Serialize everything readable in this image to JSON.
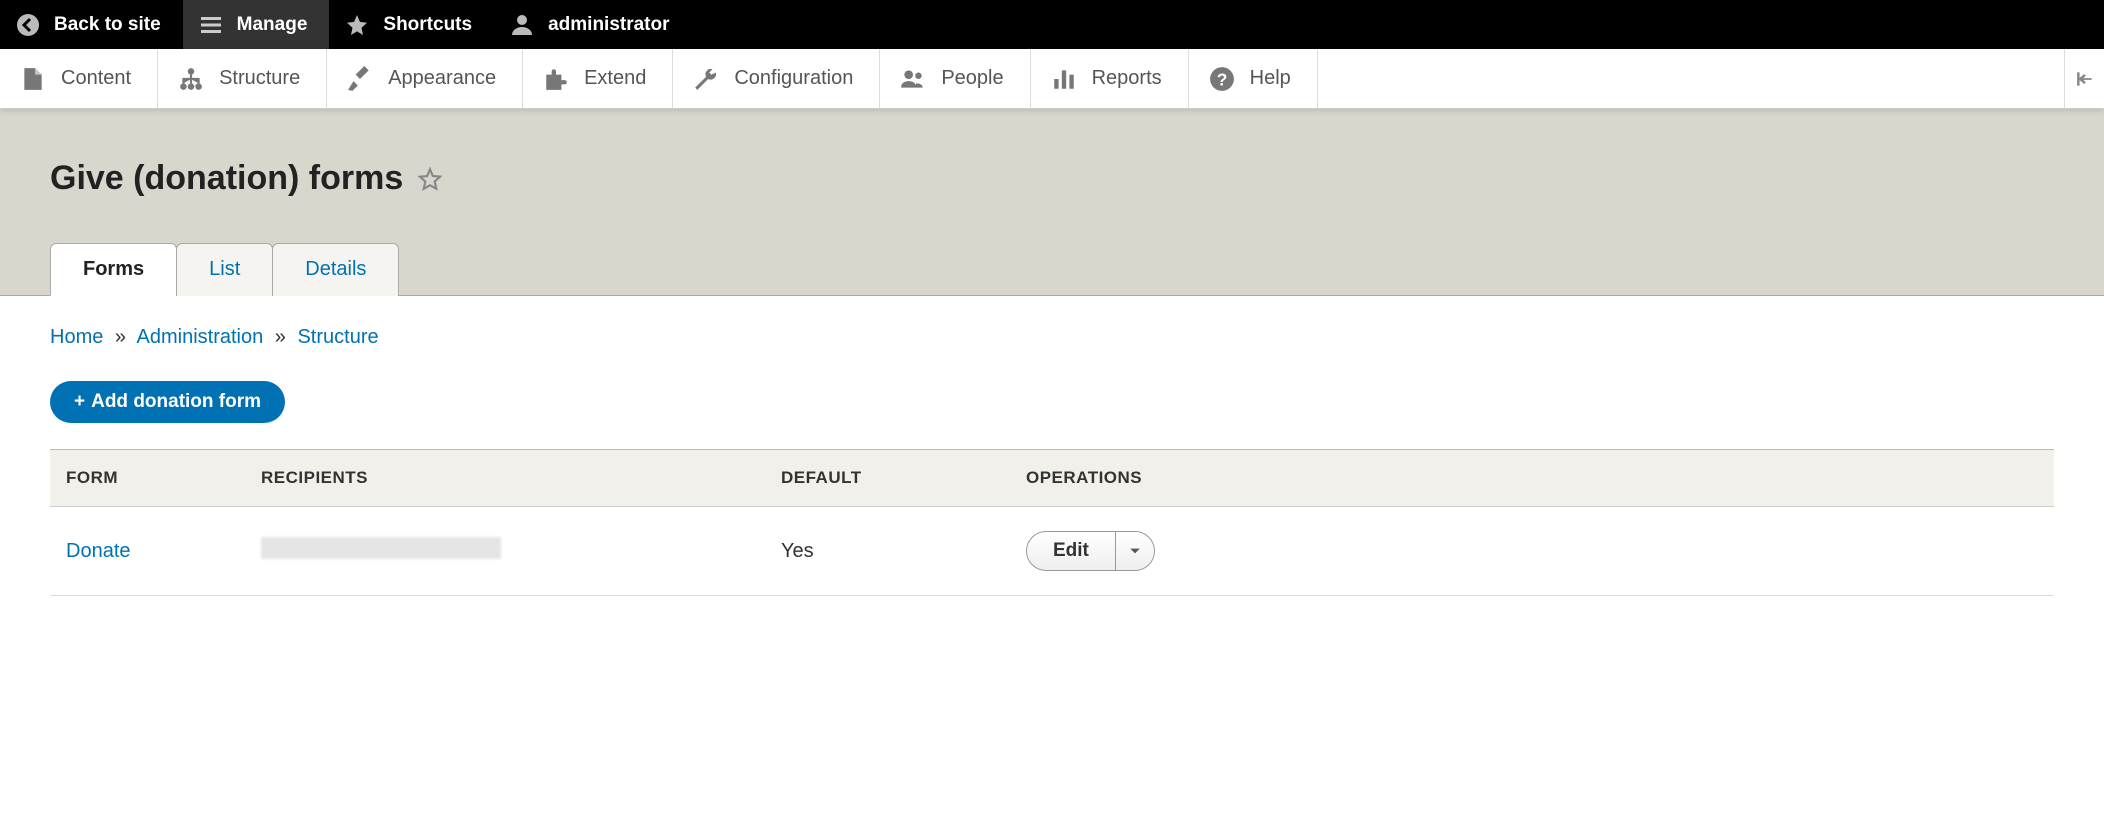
{
  "toolbar": {
    "back": "Back to site",
    "manage": "Manage",
    "shortcuts": "Shortcuts",
    "user": "administrator"
  },
  "admin_menu": {
    "content": "Content",
    "structure": "Structure",
    "appearance": "Appearance",
    "extend": "Extend",
    "configuration": "Configuration",
    "people": "People",
    "reports": "Reports",
    "help": "Help"
  },
  "page": {
    "title": "Give (donation) forms"
  },
  "tabs": [
    {
      "label": "Forms",
      "active": true
    },
    {
      "label": "List",
      "active": false
    },
    {
      "label": "Details",
      "active": false
    }
  ],
  "breadcrumb": {
    "home": "Home",
    "administration": "Administration",
    "structure": "Structure",
    "sep": "»"
  },
  "actions": {
    "add": "Add donation form"
  },
  "table": {
    "headers": {
      "form": "FORM",
      "recipients": "RECIPIENTS",
      "default": "DEFAULT",
      "operations": "OPERATIONS"
    },
    "rows": [
      {
        "form": "Donate",
        "recipients": "",
        "default": "Yes",
        "op_label": "Edit"
      }
    ]
  }
}
